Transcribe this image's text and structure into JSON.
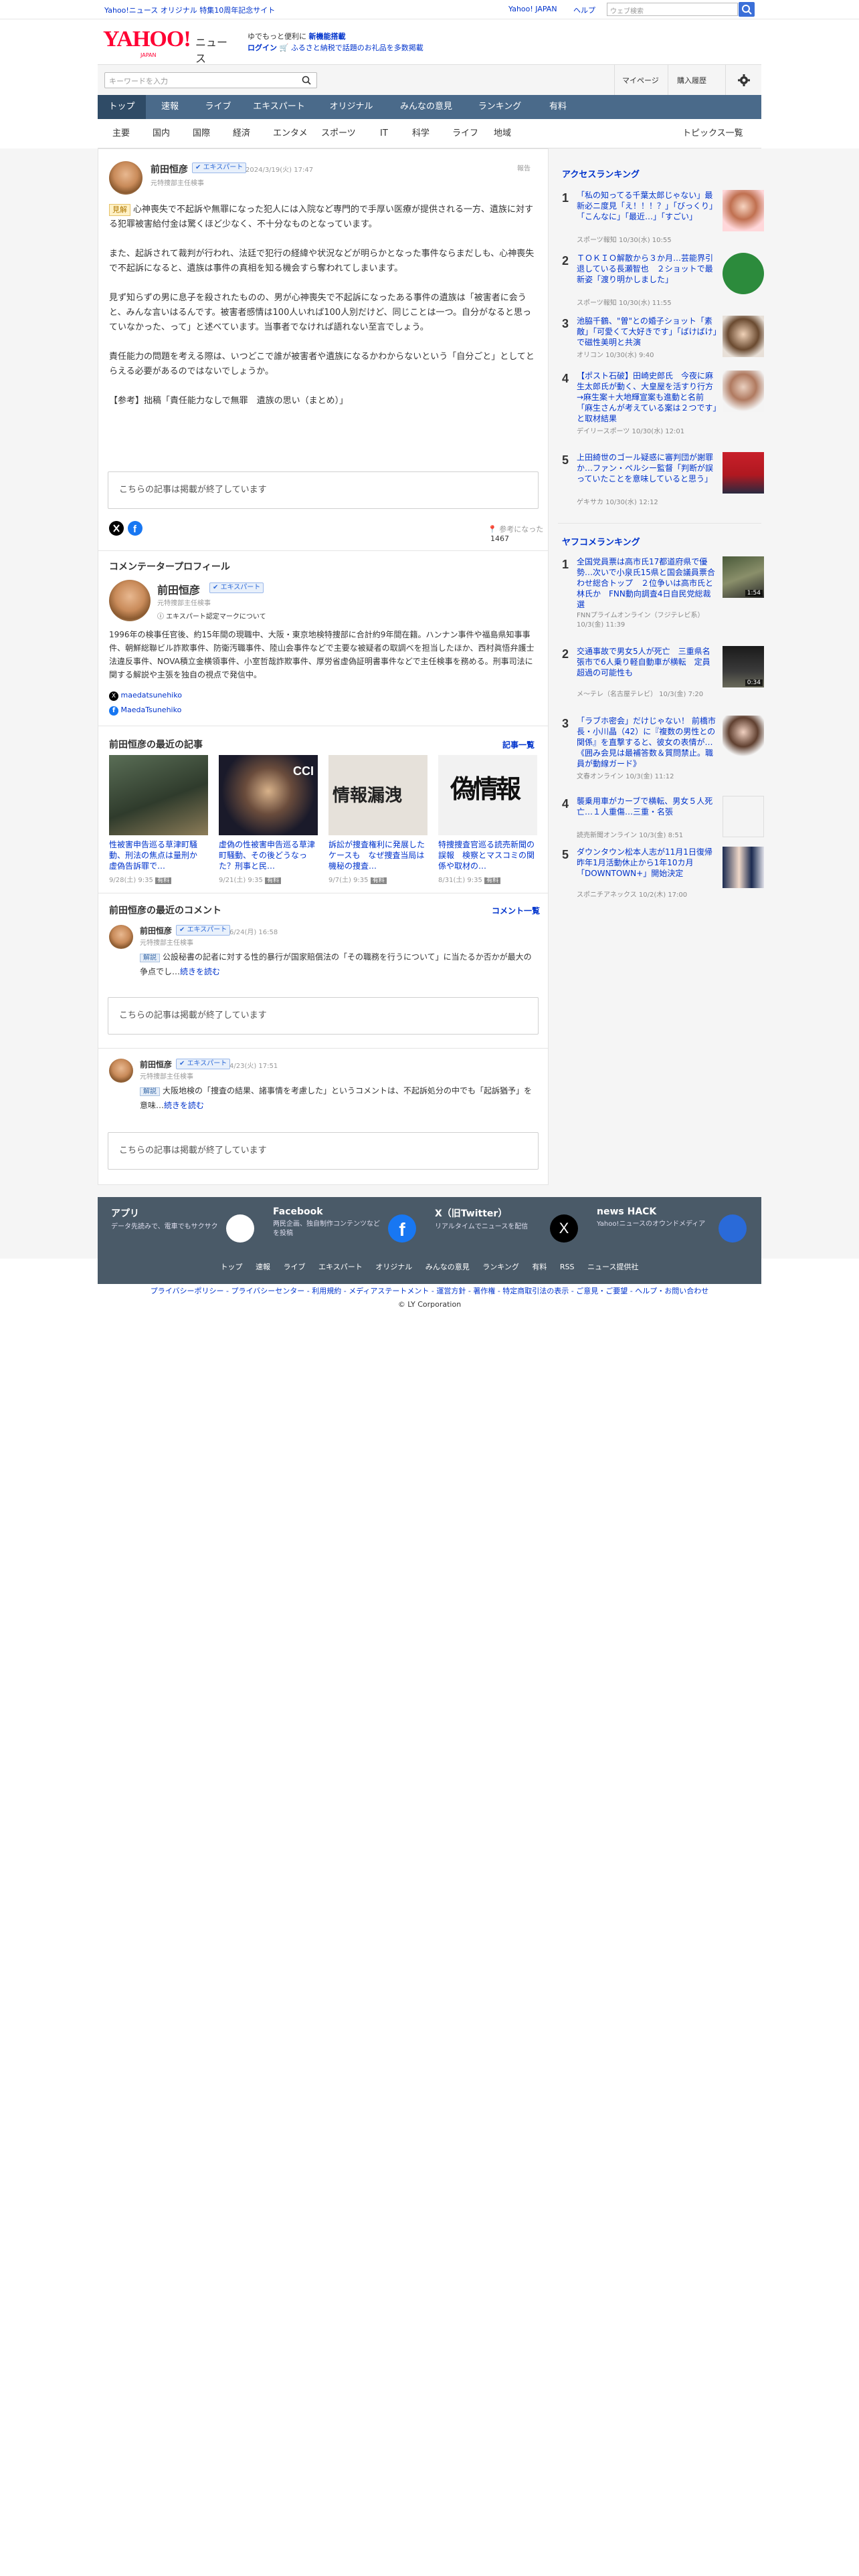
{
  "header": {
    "tagline": "Yahoo!ニュース オリジナル 特集10周年記念サイト",
    "yj_link": "Yahoo! JAPAN",
    "help": "ヘルプ",
    "search_placeholder": "ウェブ検索",
    "search_btn": "検索",
    "logo_text": "YAHOO!",
    "logo_sub": "JAPAN",
    "logo_news": "ニュース",
    "promo_line1": "ゆでもっと便利に",
    "promo_bold": "新機能搭載",
    "promo_login": "ログイン",
    "promo_line2": "ふるさと納税で話題のお礼品を多数掲載"
  },
  "searchbar": {
    "placeholder": "キーワードを入力",
    "mypage": "マイページ",
    "history": "購入履歴"
  },
  "nav": {
    "items": [
      "トップ",
      "速報",
      "ライブ",
      "エキスパート",
      "オリジナル",
      "みんなの意見",
      "ランキング",
      "有料"
    ]
  },
  "subnav": {
    "items": [
      "主要",
      "国内",
      "国際",
      "経済",
      "エンタメ",
      "スポーツ",
      "IT",
      "科学",
      "ライフ",
      "地域"
    ],
    "topics": "トピックス一覧"
  },
  "comment": {
    "author": "前田恒彦",
    "badge": "エキスパート",
    "date": "2024/3/19(火) 17:47",
    "role": "元特捜部主任検事",
    "report": "報告",
    "tag": "見解",
    "para1": "心神喪失で不起訴や無罪になった犯人には入院など専門的で手厚い医療が提供される一方、遺族に対する犯罪被害給付金は驚くほど少なく、不十分なものとなっています。",
    "para2": "また、起訴されて裁判が行われ、法廷で犯行の経緯や状況などが明らかとなった事件ならまだしも、心神喪失で不起訴になると、遺族は事件の真相を知る機会すら奪われてしまいます。",
    "para3": "見ず知らずの男に息子を殺されたものの、男が心神喪失で不起訴になったある事件の遺族は「被害者に会うと、みんな言いはるんです。被害者感情は100人いれば100人別だけど、同じことは一つ。自分がなると思っていなかった、って」と述べています。当事者でなければ語れない至言でしょう。",
    "para4": "責任能力の問題を考える際は、いつどこで誰が被害者や遺族になるかわからないという「自分ごと」としてとらえる必要があるのではないでしょうか。",
    "para5": "【参考】拙稿「責任能力なしで無罪　遺族の思い（まとめ）」",
    "ended": "こちらの記事は掲載が終了しています",
    "helpful_label": "参考になった",
    "helpful_count": "1467"
  },
  "profile": {
    "heading": "コメンテータープロフィール",
    "name": "前田恒彦",
    "badge": "エキスパート",
    "role": "元特捜部主任検事",
    "mark_link": "エキスパート認定マークについて",
    "bio": "1996年の検事任官後、約15年間の現職中、大阪・東京地検特捜部に合計約9年間在籍。ハンナン事件や福島県知事事件、朝鮮総聯ビル詐欺事件、防衛汚職事件、陸山会事件などで主要な被疑者の取調べを担当したほか、西村眞悟弁護士法違反事件、NOVA積立金横領事件、小室哲哉詐欺事件、厚労省虚偽証明書事件などで主任検事を務める。刑事司法に関する解説や主張を独自の視点で発信中。",
    "x": "maedatsunehiko",
    "fb": "MaedaTsunehiko"
  },
  "articles": {
    "heading": "前田恒彦の最近の記事",
    "more": "記事一覧",
    "items": [
      {
        "title": "性被害申告巡る草津町騒動、刑法の焦点は量刑か　虚偽告訴罪で…",
        "date": "9/28(土) 9:35",
        "tag": "有料"
      },
      {
        "title": "虚偽の性被害申告巡る草津町騒動、その後どうなった？刑事と民…",
        "date": "9/21(土) 9:35",
        "tag": "有料"
      },
      {
        "title": "訴訟が捜査権利に発展したケースも　なぜ捜査当局は機秘の捜査…",
        "date": "9/7(土) 9:35",
        "tag": "有料"
      },
      {
        "title": "特捜捜査官巡る読売新聞の誤報　検察とマスコミの関係や取材の…",
        "date": "8/31(土) 9:35",
        "tag": "有料"
      }
    ],
    "thumb_texts": [
      "",
      "CCI",
      "情報漏洩",
      "偽情報"
    ]
  },
  "recent": {
    "heading": "前田恒彦の最近のコメント",
    "more": "コメント一覧",
    "items": [
      {
        "author": "前田恒彦",
        "badge": "エキスパート",
        "date": "6/24(月) 16:58",
        "role": "元特捜部主任検事",
        "tag": "解説",
        "text": "公設秘書の記者に対する性的暴行が国家賠償法の「その職務を行うについて」に当たるか否かが最大の争点でし…",
        "more": "続きを読む",
        "ended": "こちらの記事は掲載が終了しています"
      },
      {
        "author": "前田恒彦",
        "badge": "エキスパート",
        "date": "4/23(火) 17:51",
        "role": "元特捜部主任検事",
        "tag": "解説",
        "text": "大阪地検の「捜査の結果、諸事情を考慮した」というコメントは、不起訴処分の中でも「起訴猶予」を意味…",
        "more": "続きを読む",
        "ended": "こちらの記事は掲載が終了しています"
      }
    ]
  },
  "access": {
    "heading": "アクセスランキング",
    "items": [
      {
        "no": "1",
        "title": "「私の知ってる千葉太郎じゃない」最新必ニ度見「え！！！？」「びっくり」「こんなに」「最近…」「すごい」",
        "src": "スポーツ報知 10/30(水) 10:55"
      },
      {
        "no": "2",
        "title": "ＴＯＫＩＯ解散から３か月…芸能界引退している長瀬智也　２ショットで最新姿「渡り明かしました」",
        "src": "スポーツ報知 10/30(水) 11:55"
      },
      {
        "no": "3",
        "title": "池脇千鶴、\"曽\"との婚子ショット「素敵」「可愛くて大好きです」「ばけばけ」で磁性美明と共演",
        "src": "オリコン 10/30(水) 9:40"
      },
      {
        "no": "4",
        "title": "【ポスト石破】田崎史郎氏　今夜に麻生太郎氏が動く、大皇屋を活すり行方→麻生案＋大地輝宣案も進動と名前「麻生さんが考えている案は２つです」と取材結果",
        "src": "デイリースポーツ 10/30(水) 12:01"
      },
      {
        "no": "5",
        "title": "上田綺世のゴール疑惑に審判団が謝罪か…ファン・ペルシー監督「判断が誤っていたことを意味していると思う」",
        "src": "ゲキサカ 10/30(水) 12:12"
      }
    ]
  },
  "yafuko": {
    "heading": "ヤフコメランキング",
    "items": [
      {
        "no": "1",
        "title": "全国党員票は高市氏17都道府県で優勢…次いで小泉氏15県と国会議員票合わせ総合トップ　２位争いは高市氏と林氏か　FNN動向調査4日自民党総裁選",
        "src": "FNNプライムオンライン（フジテレビ系） 10/3(金) 11:39",
        "time": "1:54"
      },
      {
        "no": "2",
        "title": "交通事故で男女5人が死亡　三重県名張市で6人乗り軽自動車が横転　定員超過の可能性も",
        "src": "メ〜テレ（名古屋テレビ） 10/3(金) 7:20",
        "time": "0:34"
      },
      {
        "no": "3",
        "title": "「ラブホ密会」だけじゃない！ 前橋市長・小川晶（42）に『複数の男性との関係』を直撃すると、彼女の表情が…《囲み会見は最補答数＆質問禁止。職員が動線ガード》",
        "src": "文春オンライン 10/3(金) 11:12",
        "time": ""
      },
      {
        "no": "4",
        "title": "襲乗用車がカーブで横転、男女５人死亡…１人重傷…三重・名張",
        "src": "読売新聞オンライン 10/3(金) 8:51",
        "time": ""
      },
      {
        "no": "5",
        "title": "ダウンタウン松本人志が11月1日復帰　昨年1月活動休止から1年10カ月「DOWNTOWN+」開始決定",
        "src": "スポニチアネックス 10/2(木) 17:00",
        "time": ""
      }
    ]
  },
  "footer": {
    "apps": [
      {
        "title": "アプリ",
        "desc": "データ先読みで、電車でもサクサク"
      },
      {
        "title": "Facebook",
        "desc": "两民企画、独自制作コンテンツなどを投稿"
      },
      {
        "title": "X（旧Twitter）",
        "desc": "リアルタイムでニュースを配信"
      },
      {
        "title": "news HACK",
        "desc": "Yahoo!ニュースのオウンドメディア"
      }
    ],
    "links": [
      "トップ",
      "速報",
      "ライブ",
      "エキスパート",
      "オリジナル",
      "みんなの意見",
      "ランキング",
      "有料",
      "RSS",
      "ニュース提供社"
    ],
    "legal": "プライバシーポリシー - プライバシーセンター - 利用規約 - メディアステートメント - 運営方針 - 著作権 - 特定商取引法の表示 - ご意見・ご要望 - ヘルプ・お問い合わせ",
    "copyright": "© LY Corporation"
  },
  "colors": {
    "nav_bg": "#4a6a8a",
    "link": "#0033cc",
    "expert_blue": "#2e6ad8",
    "footer_bg": "#4a5a68"
  }
}
